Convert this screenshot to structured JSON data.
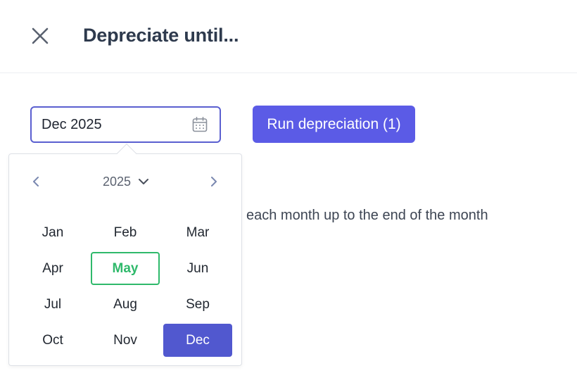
{
  "dialog": {
    "title": "Depreciate until...",
    "close_icon": "close-icon"
  },
  "date_input": {
    "value": "Dec 2025",
    "icon": "calendar-icon"
  },
  "run_button": {
    "label": "Run depreciation (1)"
  },
  "description": {
    "visible_text": "each month up to the end of the month"
  },
  "month_picker": {
    "year": "2025",
    "prev_icon": "chevron-left-icon",
    "next_icon": "chevron-right-icon",
    "year_dropdown_icon": "chevron-down-icon",
    "current_month": "May",
    "selected_month": "Dec",
    "months": [
      {
        "label": "Jan"
      },
      {
        "label": "Feb"
      },
      {
        "label": "Mar"
      },
      {
        "label": "Apr"
      },
      {
        "label": "May"
      },
      {
        "label": "Jun"
      },
      {
        "label": "Jul"
      },
      {
        "label": "Aug"
      },
      {
        "label": "Sep"
      },
      {
        "label": "Oct"
      },
      {
        "label": "Nov"
      },
      {
        "label": "Dec"
      }
    ]
  },
  "colors": {
    "accent": "#5b5be6",
    "selected_bg": "#5158cf",
    "current_month": "#2fb96b",
    "title_text": "#2e3a4d"
  }
}
